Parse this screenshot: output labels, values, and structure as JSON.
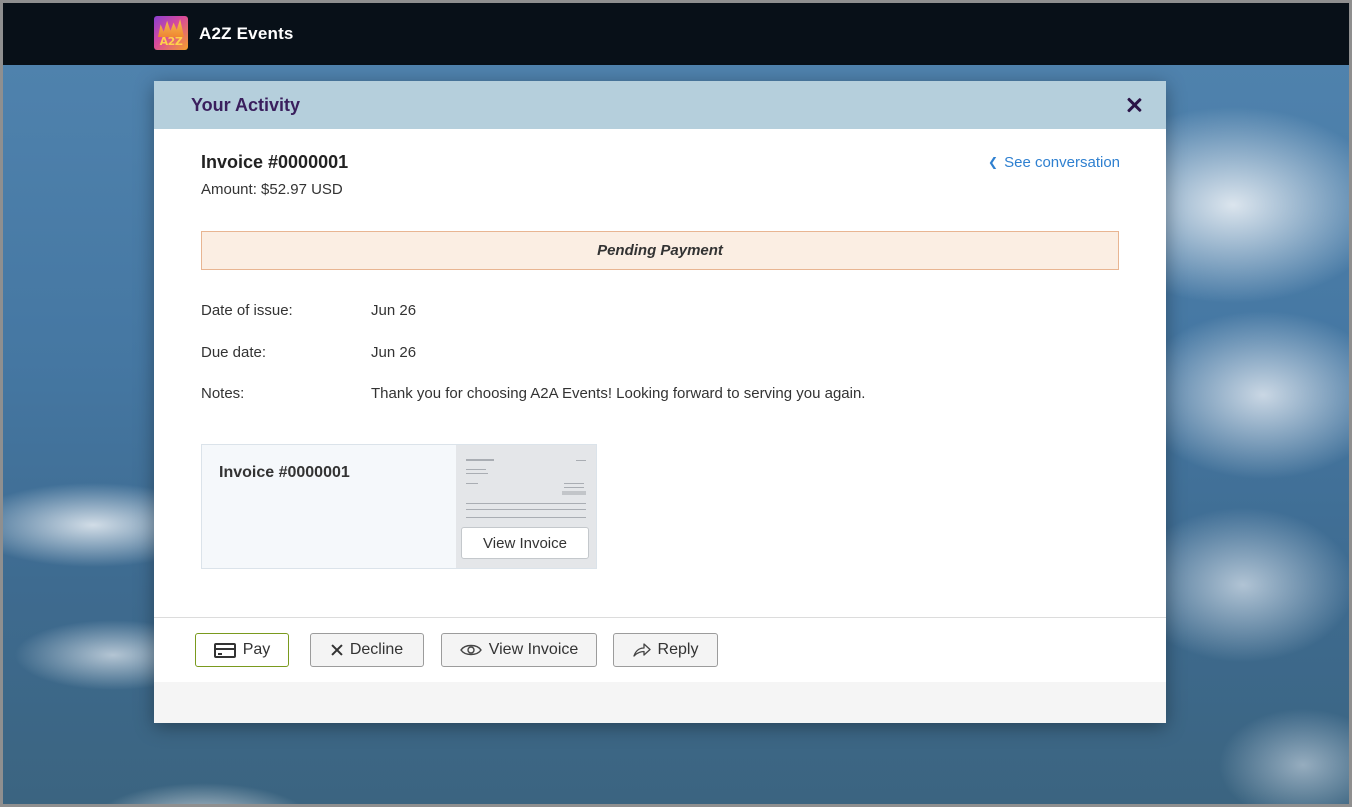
{
  "app": {
    "title": "A2Z Events",
    "logo_text": "A2Z"
  },
  "dialog": {
    "title": "Your Activity",
    "invoice_title": "Invoice #0000001",
    "amount": "Amount: $52.97 USD",
    "see_conversation": "See conversation",
    "status": "Pending Payment",
    "fields": [
      {
        "label": "Date of issue:",
        "value": "Jun 26"
      },
      {
        "label": "Due date:",
        "value": "Jun 26"
      },
      {
        "label": "Notes:",
        "value": "Thank you for choosing A2A Events! Looking forward to serving you again."
      }
    ],
    "attachment": {
      "name": "Invoice #0000001",
      "view_label": "View Invoice"
    }
  },
  "actions": {
    "pay": "Pay",
    "decline": "Decline",
    "view_invoice": "View Invoice",
    "reply": "Reply"
  },
  "colors": {
    "topbar": "#081018",
    "header": "#b5cfdc",
    "title_purple": "#3a1f5d",
    "link_blue": "#2f80d0",
    "banner_bg": "#fbeee3",
    "banner_border": "#e8b592",
    "pay_border": "#7a9a1e"
  }
}
